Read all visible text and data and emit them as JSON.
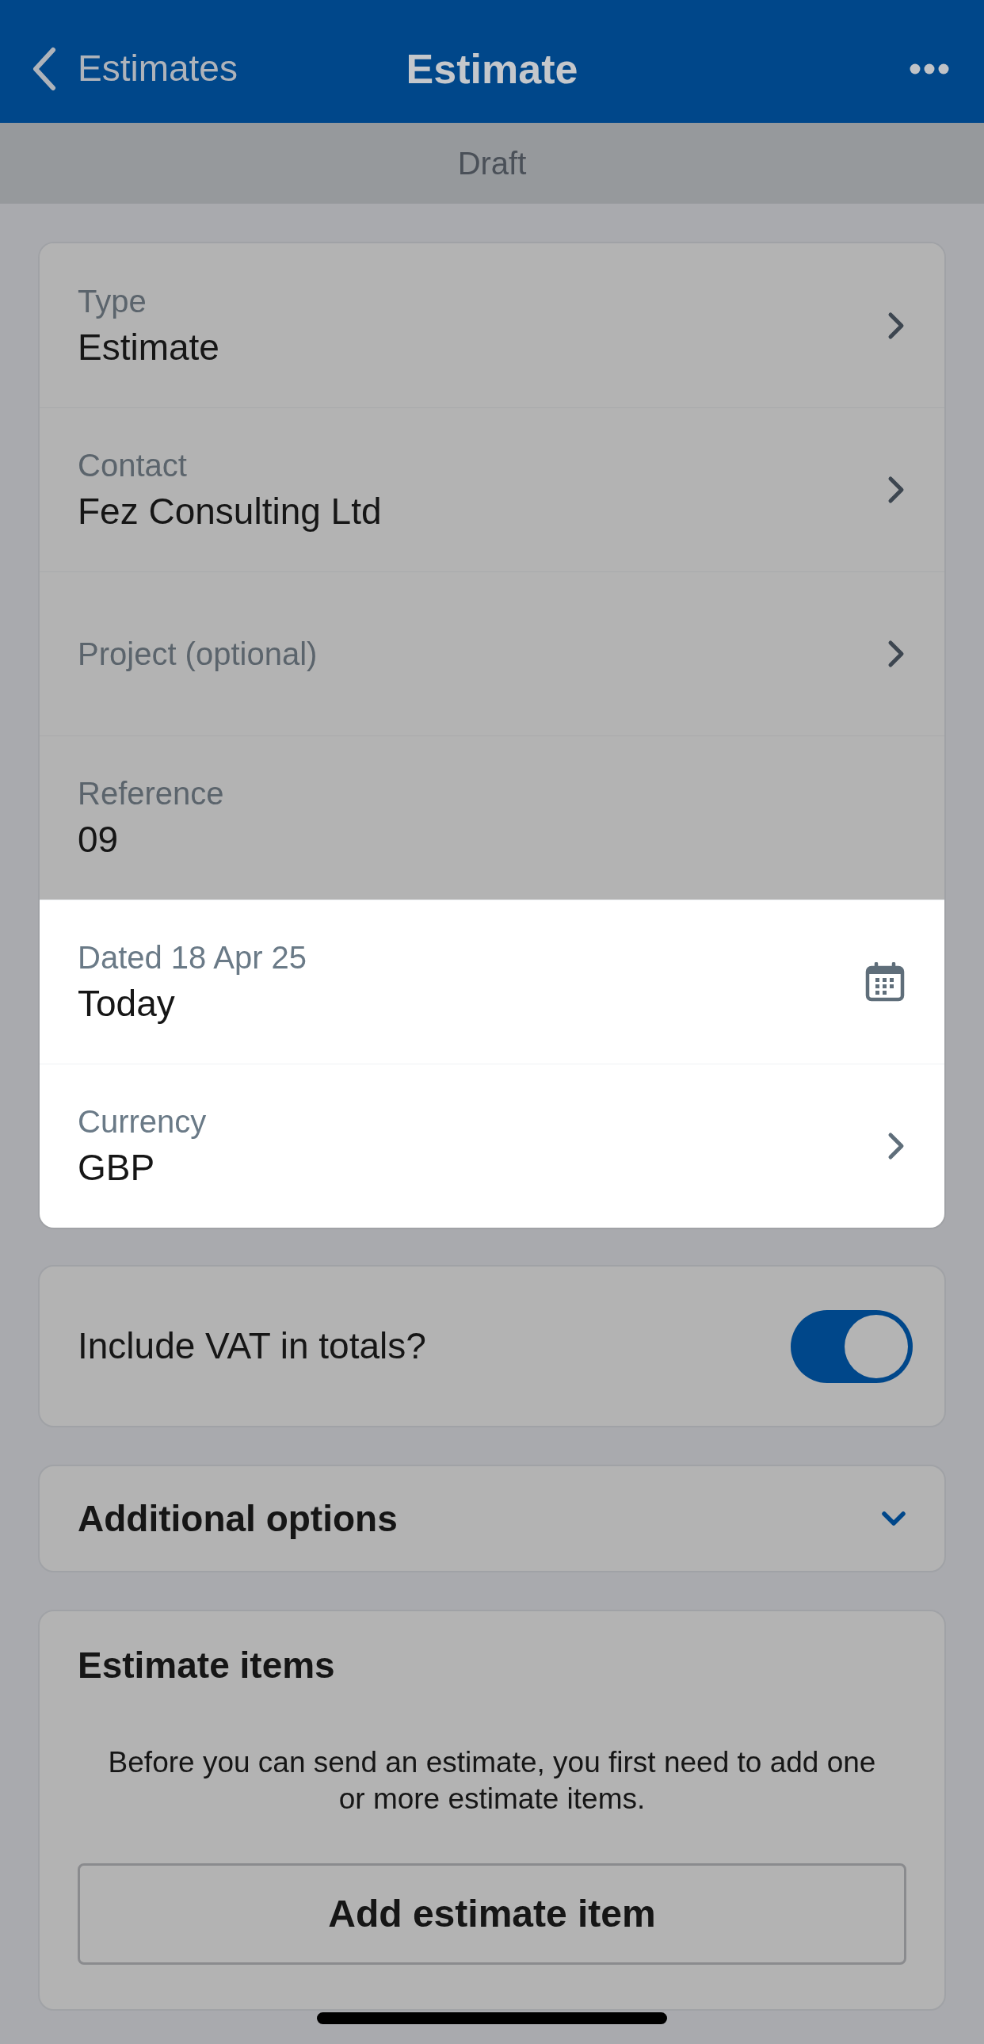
{
  "nav_bar": {
    "back_label": "Estimates",
    "title": "Estimate"
  },
  "status_banner": {
    "text": "Draft"
  },
  "fields": [
    {
      "kind": "select",
      "label": "Type",
      "value": "Estimate",
      "highlighted": false
    },
    {
      "kind": "select",
      "label": "Contact",
      "value": "Fez Consulting Ltd",
      "highlighted": false
    },
    {
      "kind": "select",
      "label": "Project (optional)",
      "highlighted": false
    },
    {
      "kind": "text",
      "label": "Reference",
      "value": "09",
      "highlighted": false
    },
    {
      "kind": "date",
      "label": "Dated 18 Apr 25",
      "value": "Today",
      "highlighted": true
    },
    {
      "kind": "select",
      "label": "Currency",
      "value": "GBP",
      "highlighted": true
    }
  ],
  "vat_toggle": {
    "label": "Include VAT in totals?",
    "on": true
  },
  "additional_options": {
    "label": "Additional options",
    "expanded": false
  },
  "estimate_items": {
    "title": "Estimate items",
    "message": "Before you can send an estimate, you first need to add one or more estimate items.",
    "button": "Add estimate item"
  }
}
